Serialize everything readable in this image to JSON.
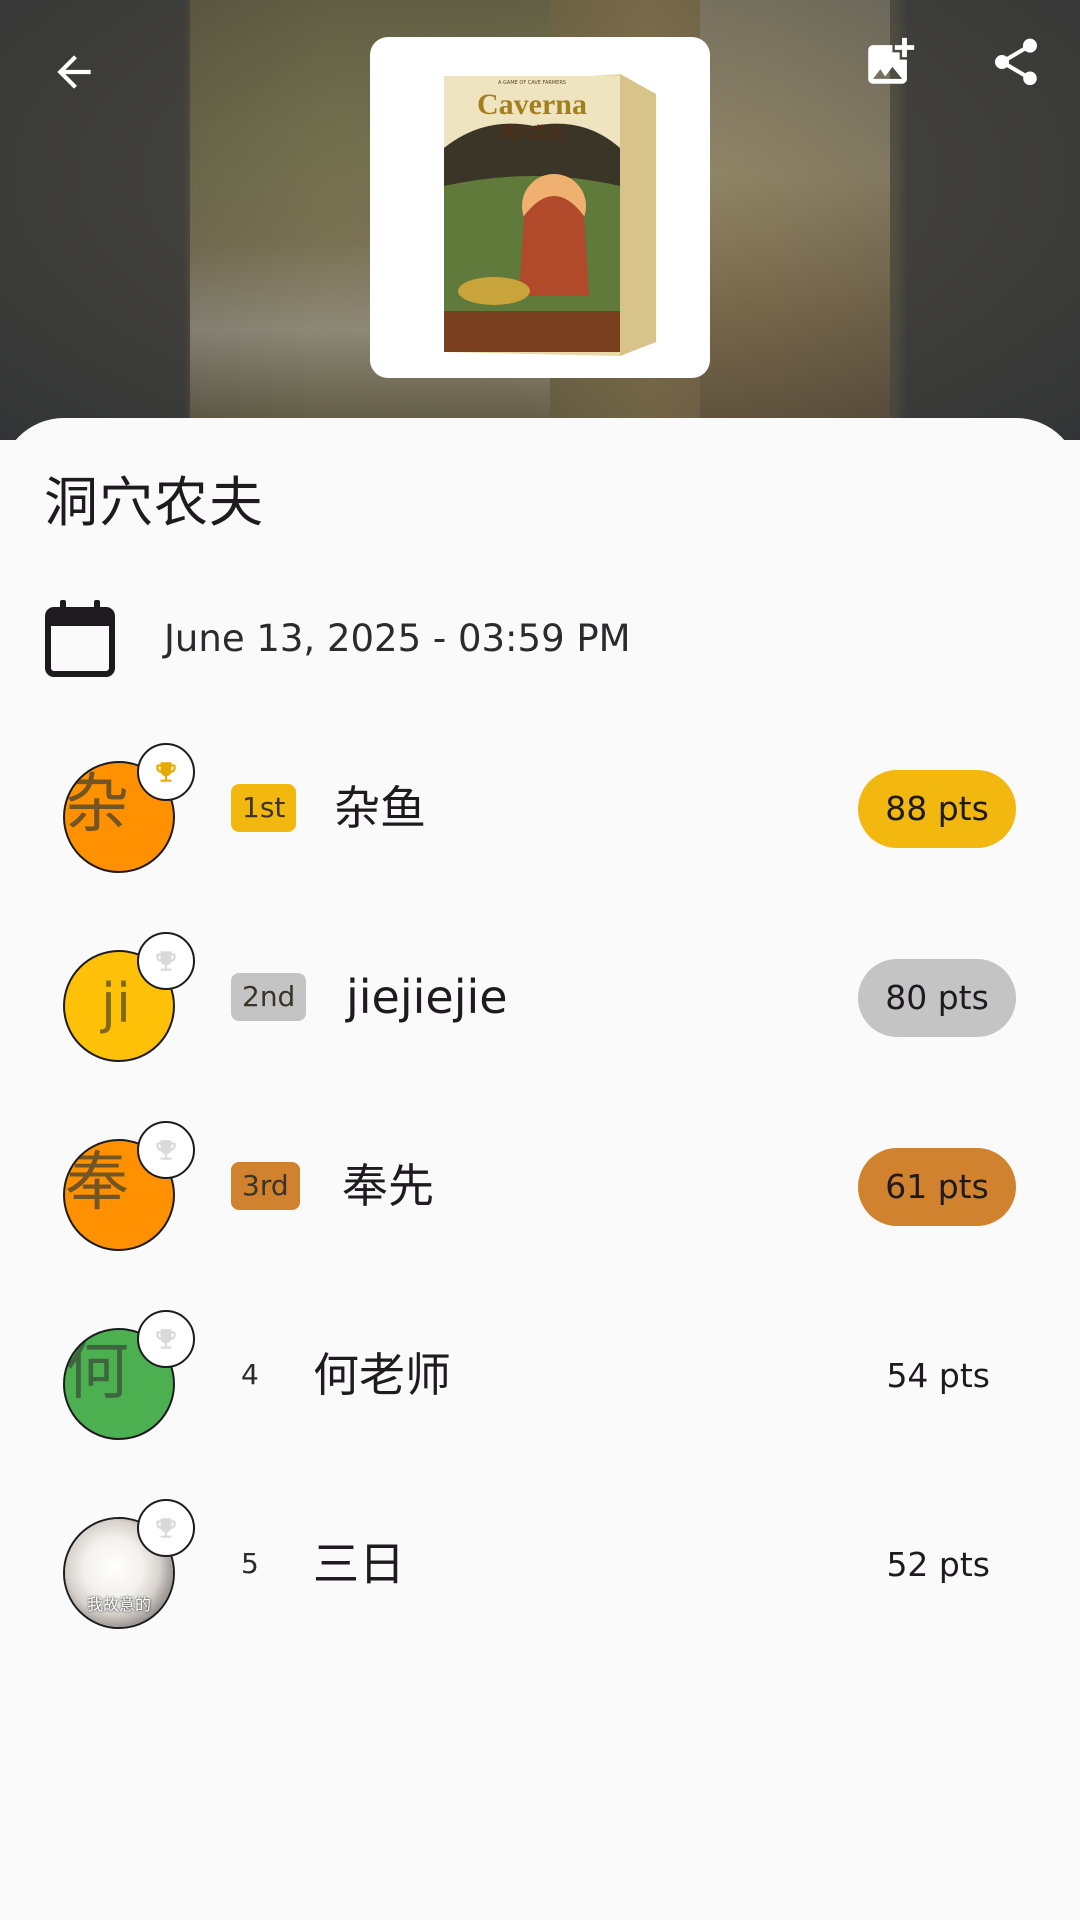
{
  "header": {
    "back_icon": "arrow-back-icon",
    "add_image_icon": "add-photo-icon",
    "share_icon": "share-icon",
    "cover": {
      "brand": "Caverna",
      "subtitle": "洞穴農夫",
      "tagline": "A GAME OF CAVE FARMERS"
    }
  },
  "game": {
    "title": "洞穴农夫",
    "date": "June 13, 2025 - 03:59 PM",
    "calendar_icon": "calendar-icon"
  },
  "colors": {
    "gold": "#f2b80f",
    "silver": "#c4c4c4",
    "bronze": "#d0822e",
    "avatar_orange": "#ff9100",
    "avatar_yellow": "#ffc107",
    "avatar_green": "#4caf50"
  },
  "players": [
    {
      "name": "杂鱼",
      "initial": "杂",
      "rank": "1st",
      "score": "88 pts",
      "avatar_color": "#ff9100",
      "trophy": "gold"
    },
    {
      "name": "jiejiejie",
      "initial": "ji",
      "rank": "2nd",
      "score": "80 pts",
      "avatar_color": "#ffc107",
      "trophy": "grey"
    },
    {
      "name": "奉先",
      "initial": "奉",
      "rank": "3rd",
      "score": "61 pts",
      "avatar_color": "#ff9100",
      "trophy": "grey"
    },
    {
      "name": "何老师",
      "initial": "何",
      "rank": "4",
      "score": "54 pts",
      "avatar_color": "#4caf50",
      "trophy": "grey"
    },
    {
      "name": "三日",
      "avatar_caption": "我故意的",
      "rank": "5",
      "score": "52 pts",
      "avatar_color": "photo",
      "trophy": "grey"
    }
  ]
}
